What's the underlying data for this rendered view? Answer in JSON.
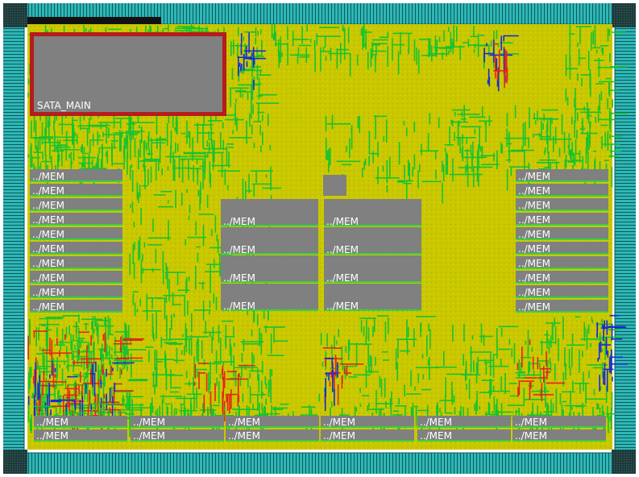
{
  "block_labels": {
    "sata_main": "SATA_MAIN",
    "mem": "../MEM"
  },
  "colors": {
    "io_ring": "#2fb7b7",
    "io_ring_dark": "#0c5a5a",
    "corner": "#1f3b3b",
    "core_fill": "#c9c800",
    "core_routing_green": "#18c22e",
    "core_routing_red": "#e2261a",
    "core_routing_blue": "#1b2ad6",
    "macro_fill": "#808080",
    "macro_outline_green": "#38d23c",
    "sata_outline": "#b51c1c",
    "label": "#ffffff"
  },
  "macros": {
    "sata_main_count": 1,
    "mem_left_column_count": 10,
    "mem_right_column_count": 10,
    "mem_center_left_count": 4,
    "mem_center_right_count": 4,
    "mem_bottom_row_count": 12
  }
}
